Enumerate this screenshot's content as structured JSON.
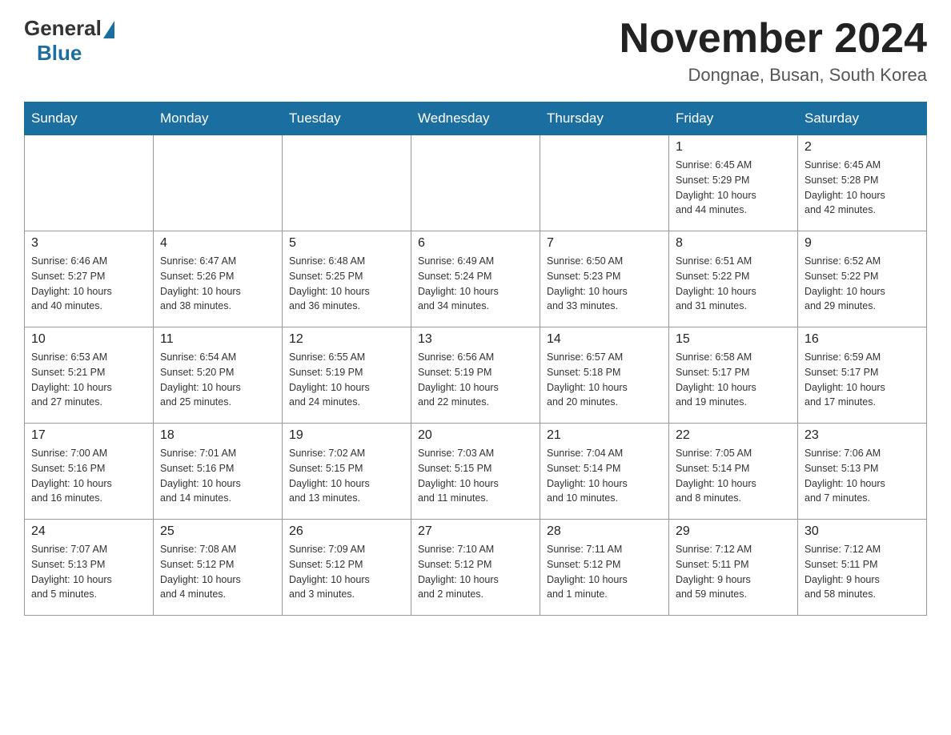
{
  "header": {
    "logo_general": "General",
    "logo_blue": "Blue",
    "month_title": "November 2024",
    "location": "Dongnae, Busan, South Korea"
  },
  "days_of_week": [
    "Sunday",
    "Monday",
    "Tuesday",
    "Wednesday",
    "Thursday",
    "Friday",
    "Saturday"
  ],
  "weeks": [
    [
      {
        "day": "",
        "info": ""
      },
      {
        "day": "",
        "info": ""
      },
      {
        "day": "",
        "info": ""
      },
      {
        "day": "",
        "info": ""
      },
      {
        "day": "",
        "info": ""
      },
      {
        "day": "1",
        "info": "Sunrise: 6:45 AM\nSunset: 5:29 PM\nDaylight: 10 hours\nand 44 minutes."
      },
      {
        "day": "2",
        "info": "Sunrise: 6:45 AM\nSunset: 5:28 PM\nDaylight: 10 hours\nand 42 minutes."
      }
    ],
    [
      {
        "day": "3",
        "info": "Sunrise: 6:46 AM\nSunset: 5:27 PM\nDaylight: 10 hours\nand 40 minutes."
      },
      {
        "day": "4",
        "info": "Sunrise: 6:47 AM\nSunset: 5:26 PM\nDaylight: 10 hours\nand 38 minutes."
      },
      {
        "day": "5",
        "info": "Sunrise: 6:48 AM\nSunset: 5:25 PM\nDaylight: 10 hours\nand 36 minutes."
      },
      {
        "day": "6",
        "info": "Sunrise: 6:49 AM\nSunset: 5:24 PM\nDaylight: 10 hours\nand 34 minutes."
      },
      {
        "day": "7",
        "info": "Sunrise: 6:50 AM\nSunset: 5:23 PM\nDaylight: 10 hours\nand 33 minutes."
      },
      {
        "day": "8",
        "info": "Sunrise: 6:51 AM\nSunset: 5:22 PM\nDaylight: 10 hours\nand 31 minutes."
      },
      {
        "day": "9",
        "info": "Sunrise: 6:52 AM\nSunset: 5:22 PM\nDaylight: 10 hours\nand 29 minutes."
      }
    ],
    [
      {
        "day": "10",
        "info": "Sunrise: 6:53 AM\nSunset: 5:21 PM\nDaylight: 10 hours\nand 27 minutes."
      },
      {
        "day": "11",
        "info": "Sunrise: 6:54 AM\nSunset: 5:20 PM\nDaylight: 10 hours\nand 25 minutes."
      },
      {
        "day": "12",
        "info": "Sunrise: 6:55 AM\nSunset: 5:19 PM\nDaylight: 10 hours\nand 24 minutes."
      },
      {
        "day": "13",
        "info": "Sunrise: 6:56 AM\nSunset: 5:19 PM\nDaylight: 10 hours\nand 22 minutes."
      },
      {
        "day": "14",
        "info": "Sunrise: 6:57 AM\nSunset: 5:18 PM\nDaylight: 10 hours\nand 20 minutes."
      },
      {
        "day": "15",
        "info": "Sunrise: 6:58 AM\nSunset: 5:17 PM\nDaylight: 10 hours\nand 19 minutes."
      },
      {
        "day": "16",
        "info": "Sunrise: 6:59 AM\nSunset: 5:17 PM\nDaylight: 10 hours\nand 17 minutes."
      }
    ],
    [
      {
        "day": "17",
        "info": "Sunrise: 7:00 AM\nSunset: 5:16 PM\nDaylight: 10 hours\nand 16 minutes."
      },
      {
        "day": "18",
        "info": "Sunrise: 7:01 AM\nSunset: 5:16 PM\nDaylight: 10 hours\nand 14 minutes."
      },
      {
        "day": "19",
        "info": "Sunrise: 7:02 AM\nSunset: 5:15 PM\nDaylight: 10 hours\nand 13 minutes."
      },
      {
        "day": "20",
        "info": "Sunrise: 7:03 AM\nSunset: 5:15 PM\nDaylight: 10 hours\nand 11 minutes."
      },
      {
        "day": "21",
        "info": "Sunrise: 7:04 AM\nSunset: 5:14 PM\nDaylight: 10 hours\nand 10 minutes."
      },
      {
        "day": "22",
        "info": "Sunrise: 7:05 AM\nSunset: 5:14 PM\nDaylight: 10 hours\nand 8 minutes."
      },
      {
        "day": "23",
        "info": "Sunrise: 7:06 AM\nSunset: 5:13 PM\nDaylight: 10 hours\nand 7 minutes."
      }
    ],
    [
      {
        "day": "24",
        "info": "Sunrise: 7:07 AM\nSunset: 5:13 PM\nDaylight: 10 hours\nand 5 minutes."
      },
      {
        "day": "25",
        "info": "Sunrise: 7:08 AM\nSunset: 5:12 PM\nDaylight: 10 hours\nand 4 minutes."
      },
      {
        "day": "26",
        "info": "Sunrise: 7:09 AM\nSunset: 5:12 PM\nDaylight: 10 hours\nand 3 minutes."
      },
      {
        "day": "27",
        "info": "Sunrise: 7:10 AM\nSunset: 5:12 PM\nDaylight: 10 hours\nand 2 minutes."
      },
      {
        "day": "28",
        "info": "Sunrise: 7:11 AM\nSunset: 5:12 PM\nDaylight: 10 hours\nand 1 minute."
      },
      {
        "day": "29",
        "info": "Sunrise: 7:12 AM\nSunset: 5:11 PM\nDaylight: 9 hours\nand 59 minutes."
      },
      {
        "day": "30",
        "info": "Sunrise: 7:12 AM\nSunset: 5:11 PM\nDaylight: 9 hours\nand 58 minutes."
      }
    ]
  ]
}
